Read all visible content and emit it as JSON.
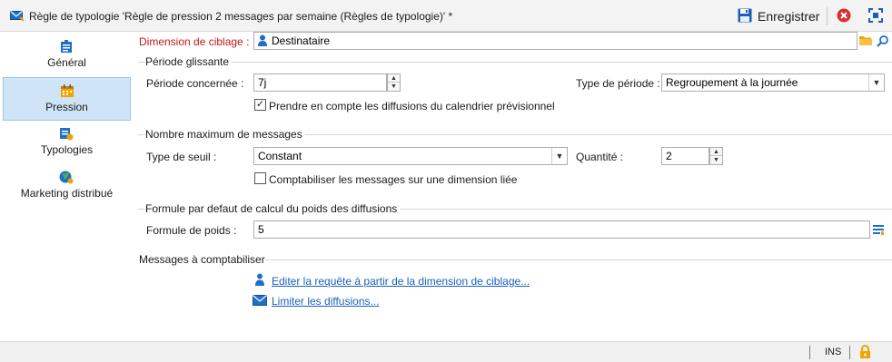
{
  "window": {
    "title": "Règle de typologie 'Règle de pression 2 messages par semaine (Règles de typologie)' *",
    "save_label": "Enregistrer"
  },
  "sidebar": {
    "items": [
      {
        "label": "Général",
        "icon": "general-icon",
        "active": false
      },
      {
        "label": "Pression",
        "icon": "calendar-icon",
        "active": true
      },
      {
        "label": "Typologies",
        "icon": "typology-icon",
        "active": false
      },
      {
        "label": "Marketing distribué",
        "icon": "globe-icon",
        "active": false
      }
    ]
  },
  "target": {
    "label": "Dimension de ciblage :",
    "value": "Destinataire"
  },
  "sliding_period": {
    "title": "Période glissante",
    "period_label": "Période concernée :",
    "period_value": "7j",
    "period_type_label": "Type de période :",
    "period_type_value": "Regroupement à la journée",
    "calendar_checkbox_label": "Prendre en compte les diffusions du calendrier prévisionnel",
    "calendar_checked": true
  },
  "max_messages": {
    "title": "Nombre maximum de messages",
    "threshold_label": "Type de seuil :",
    "threshold_value": "Constant",
    "quantity_label": "Quantité :",
    "quantity_value": "2",
    "linked_checkbox_label": "Comptabiliser les messages sur une dimension liée",
    "linked_checked": false
  },
  "weight_formula": {
    "title": "Formule par defaut de calcul du poids des diffusions",
    "label": "Formule de poids :",
    "value": "5"
  },
  "messages": {
    "title": "Messages à comptabiliser",
    "edit_query_link": "Editer la requête à partir de la dimension de ciblage...",
    "limit_link": "Limiter les diffusions..."
  },
  "statusbar": {
    "mode": "INS"
  },
  "colors": {
    "accent": "#1b5fbf",
    "selected_bg": "#cfe4f7",
    "required_label": "#c01818",
    "close_red": "#d93030",
    "lock_orange": "#f0a400"
  }
}
